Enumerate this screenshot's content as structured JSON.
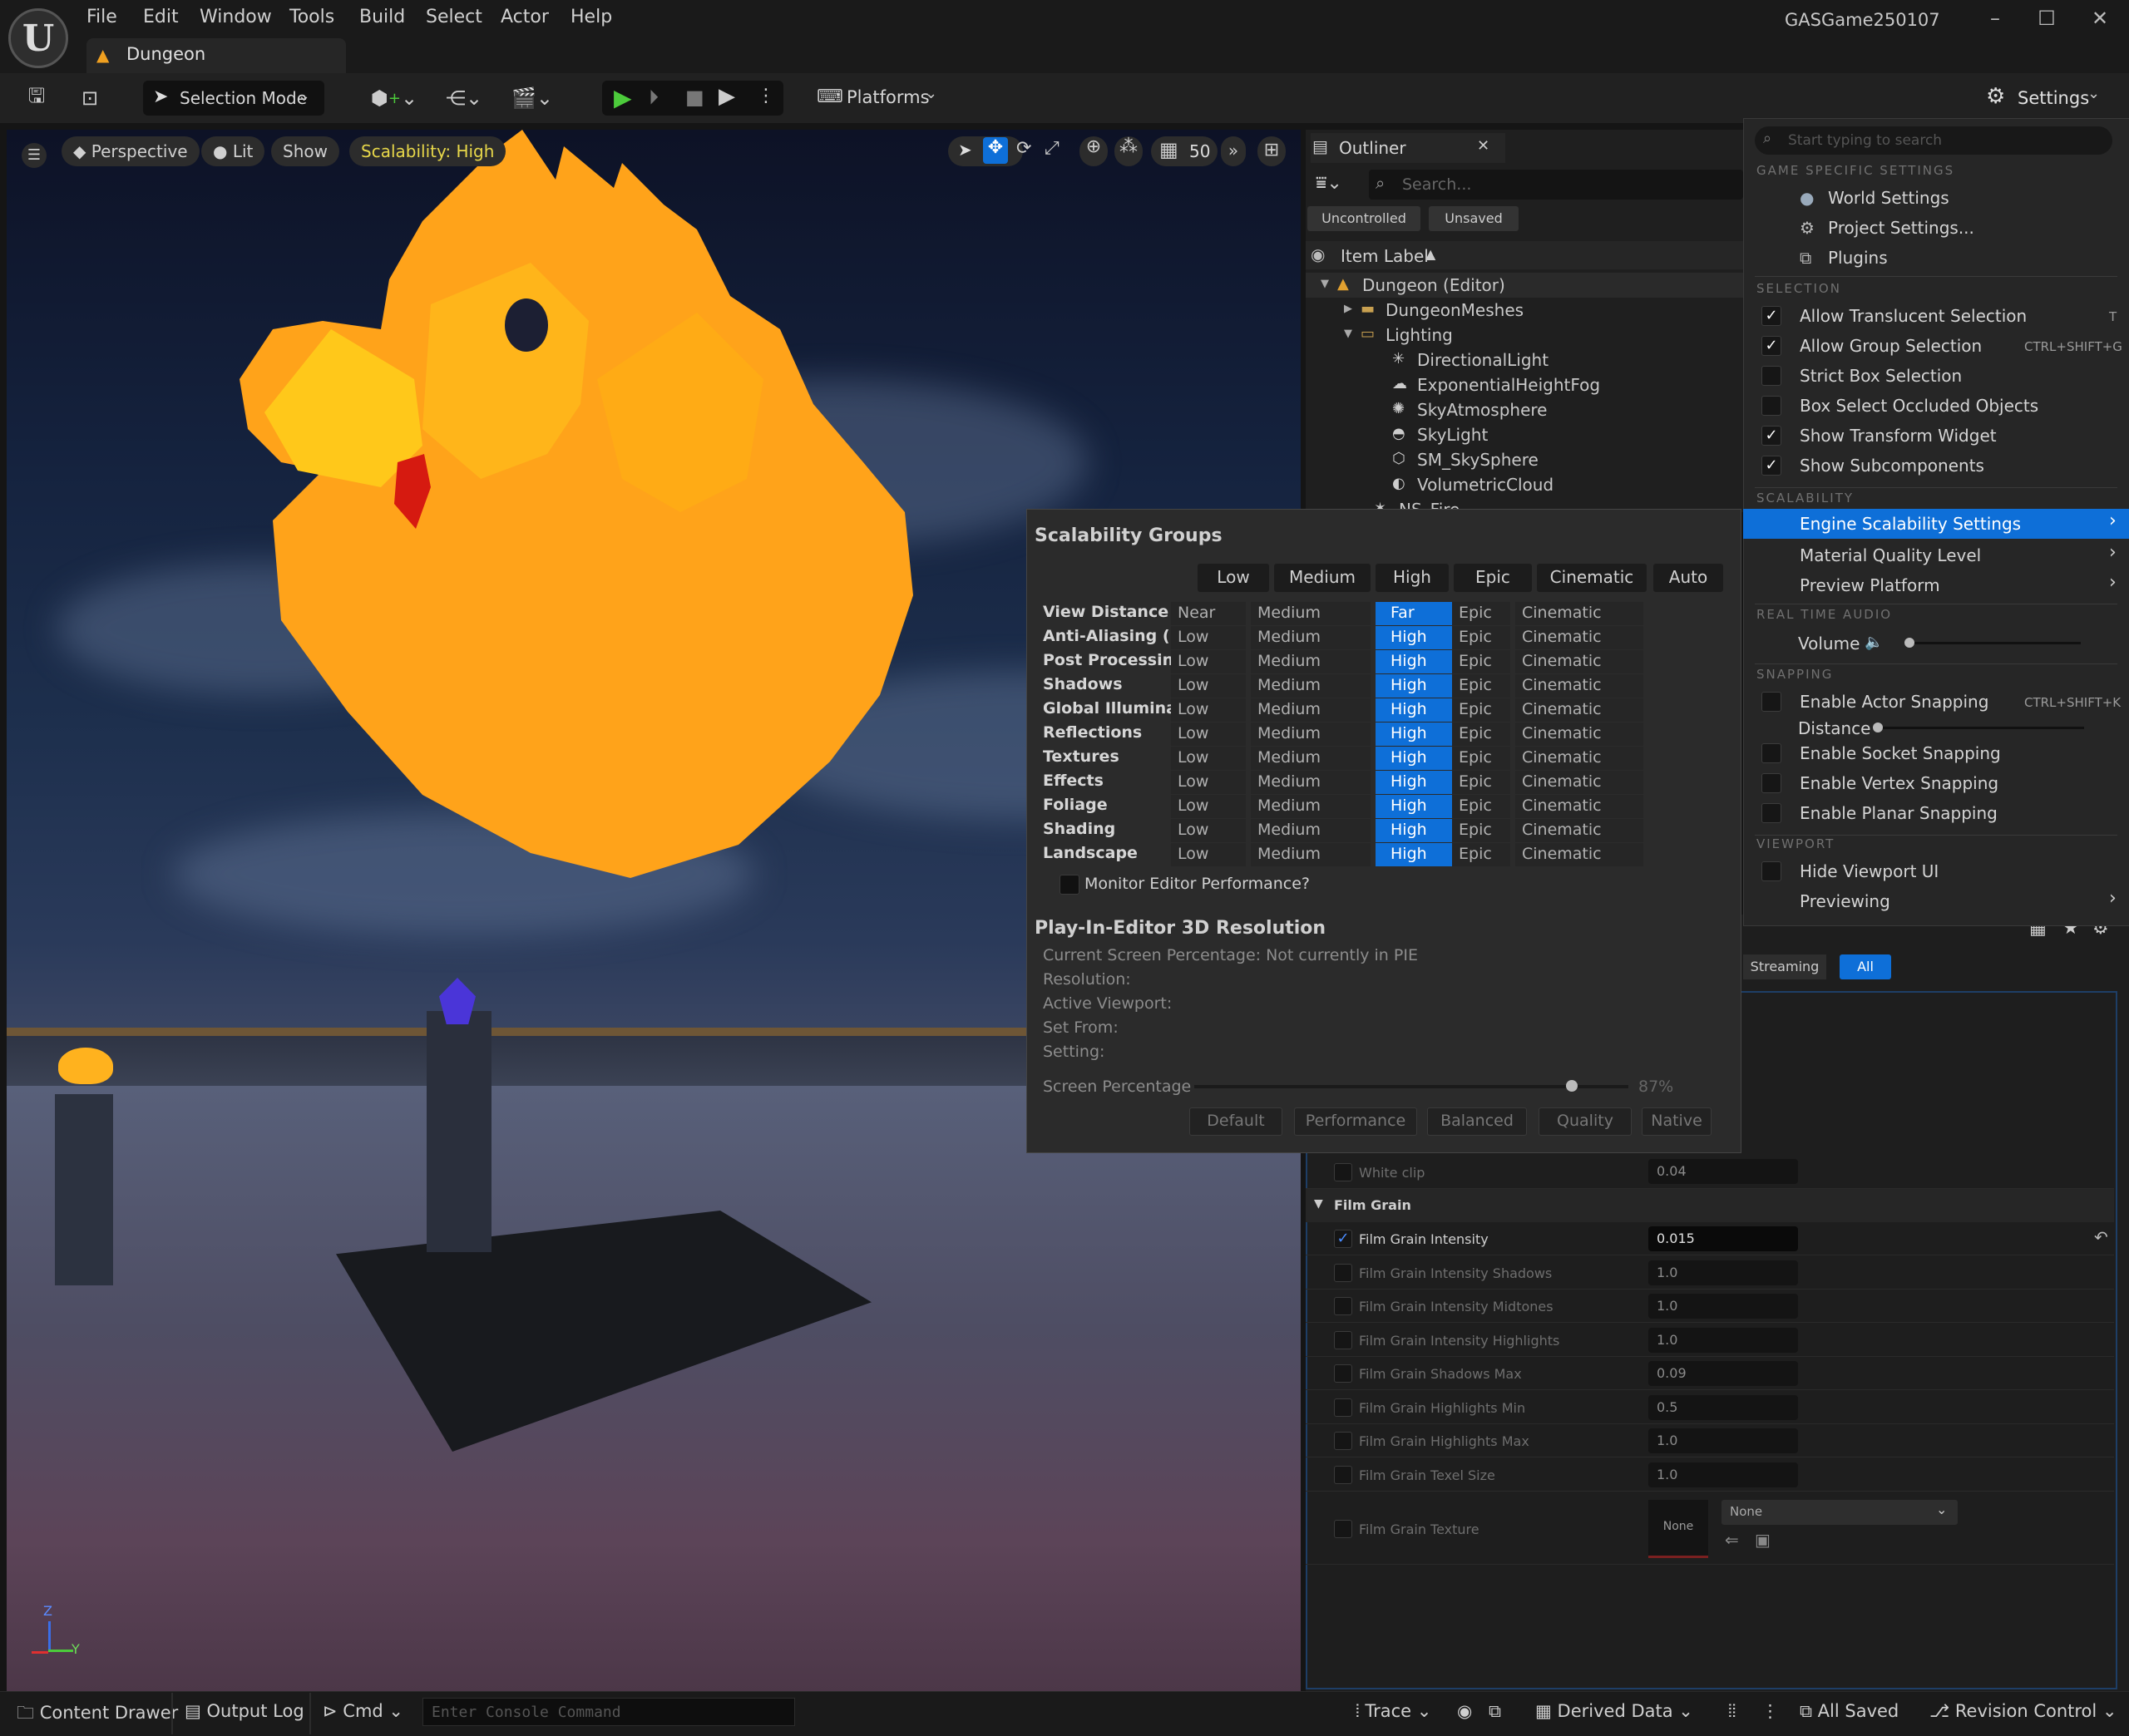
{
  "app": {
    "window_title": "GASGame250107",
    "level_tab": "Dungeon",
    "menu": [
      "File",
      "Edit",
      "Window",
      "Tools",
      "Build",
      "Select",
      "Actor",
      "Help"
    ]
  },
  "toolbar": {
    "selection_mode": "Selection Mode",
    "platforms": "Platforms",
    "settings": "Settings"
  },
  "viewport": {
    "perspective": "Perspective",
    "lit": "Lit",
    "show": "Show",
    "scalability_badge": "Scalability: High",
    "grid_size": "50",
    "axis_z": "Z",
    "axis_y": "Y"
  },
  "outliner": {
    "title": "Outliner",
    "search_placeholder": "Search...",
    "filter_uncontrolled": "Uncontrolled",
    "filter_unsaved": "Unsaved",
    "column": "Item Label",
    "items": [
      {
        "label": "Dungeon (Editor)",
        "icon": "level-icon"
      },
      {
        "label": "DungeonMeshes",
        "icon": "folder-icon"
      },
      {
        "label": "Lighting",
        "icon": "folder-open-icon"
      },
      {
        "label": "DirectionalLight",
        "icon": "directional-light-icon"
      },
      {
        "label": "ExponentialHeightFog",
        "icon": "fog-icon"
      },
      {
        "label": "SkyAtmosphere",
        "icon": "sky-atmosphere-icon"
      },
      {
        "label": "SkyLight",
        "icon": "sky-light-icon"
      },
      {
        "label": "SM_SkySphere",
        "icon": "static-mesh-icon"
      },
      {
        "label": "VolumetricCloud",
        "icon": "cloud-icon"
      },
      {
        "label": "NS_Fire",
        "icon": "niagara-icon"
      }
    ]
  },
  "scalability": {
    "title": "Scalability Groups",
    "presets": [
      "Low",
      "Medium",
      "High",
      "Epic",
      "Cinematic",
      "Auto"
    ],
    "groups": [
      {
        "name": "View Distance",
        "levels": [
          "Near",
          "Medium",
          "Far",
          "Epic",
          "Cinematic"
        ]
      },
      {
        "name": "Anti-Aliasing (None)",
        "levels": [
          "Low",
          "Medium",
          "High",
          "Epic",
          "Cinematic"
        ]
      },
      {
        "name": "Post Processing",
        "levels": [
          "Low",
          "Medium",
          "High",
          "Epic",
          "Cinematic"
        ]
      },
      {
        "name": "Shadows",
        "levels": [
          "Low",
          "Medium",
          "High",
          "Epic",
          "Cinematic"
        ]
      },
      {
        "name": "Global Illumination",
        "levels": [
          "Low",
          "Medium",
          "High",
          "Epic",
          "Cinematic"
        ]
      },
      {
        "name": "Reflections",
        "levels": [
          "Low",
          "Medium",
          "High",
          "Epic",
          "Cinematic"
        ]
      },
      {
        "name": "Textures",
        "levels": [
          "Low",
          "Medium",
          "High",
          "Epic",
          "Cinematic"
        ]
      },
      {
        "name": "Effects",
        "levels": [
          "Low",
          "Medium",
          "High",
          "Epic",
          "Cinematic"
        ]
      },
      {
        "name": "Foliage",
        "levels": [
          "Low",
          "Medium",
          "High",
          "Epic",
          "Cinematic"
        ]
      },
      {
        "name": "Shading",
        "levels": [
          "Low",
          "Medium",
          "High",
          "Epic",
          "Cinematic"
        ]
      },
      {
        "name": "Landscape",
        "levels": [
          "Low",
          "Medium",
          "High",
          "Epic",
          "Cinematic"
        ]
      }
    ],
    "selected_index": 2,
    "monitor_label": "Monitor Editor Performance?",
    "pie_title": "Play-In-Editor 3D Resolution",
    "pie_lines": [
      "Current Screen Percentage: Not currently in PIE",
      "Resolution:",
      "Active Viewport:",
      "Set From:",
      "Setting:"
    ],
    "screen_percentage_label": "Screen Percentage",
    "screen_percentage_value": "87%",
    "screen_percentage_fraction": 0.87,
    "pie_buttons": [
      "Default",
      "Performance",
      "Balanced",
      "Quality",
      "Native"
    ]
  },
  "settings_menu": {
    "search_placeholder": "Start typing to search",
    "sections": {
      "game": "GAME SPECIFIC SETTINGS",
      "selection": "SELECTION",
      "scalability": "SCALABILITY",
      "audio": "REAL TIME AUDIO",
      "snapping": "SNAPPING",
      "viewport": "VIEWPORT"
    },
    "game_items": [
      "World Settings",
      "Project Settings...",
      "Plugins"
    ],
    "selection_items": [
      {
        "label": "Allow Translucent Selection",
        "checked": true,
        "shortcut": "T"
      },
      {
        "label": "Allow Group Selection",
        "checked": true,
        "shortcut": "CTRL+SHIFT+G"
      },
      {
        "label": "Strict Box Selection",
        "checked": false,
        "shortcut": ""
      },
      {
        "label": "Box Select Occluded Objects",
        "checked": false,
        "shortcut": ""
      },
      {
        "label": "Show Transform Widget",
        "checked": true,
        "shortcut": ""
      },
      {
        "label": "Show Subcomponents",
        "checked": true,
        "shortcut": ""
      }
    ],
    "scalability_items": [
      "Engine Scalability Settings",
      "Material Quality Level",
      "Preview Platform"
    ],
    "volume_label": "Volume",
    "volume_level": 0.0,
    "snapping_actor": "Enable Actor Snapping",
    "snapping_actor_shortcut": "CTRL+SHIFT+K",
    "distance_label": "Distance",
    "snapping_items": [
      "Enable Socket Snapping",
      "Enable Vertex Snapping",
      "Enable Planar Snapping"
    ],
    "viewport_items": [
      "Hide Viewport UI",
      "Previewing"
    ]
  },
  "details": {
    "filter_streaming": "Streaming",
    "filter_all": "All",
    "white_clip_label": "White clip",
    "white_clip_value": "0.04",
    "film_grain_section": "Film Grain",
    "rows": [
      {
        "label": "Film Grain Intensity",
        "value": "0.015",
        "checked": true
      },
      {
        "label": "Film Grain Intensity Shadows",
        "value": "1.0",
        "checked": false
      },
      {
        "label": "Film Grain Intensity Midtones",
        "value": "1.0",
        "checked": false
      },
      {
        "label": "Film Grain Intensity Highlights",
        "value": "1.0",
        "checked": false
      },
      {
        "label": "Film Grain Shadows Max",
        "value": "0.09",
        "checked": false
      },
      {
        "label": "Film Grain Highlights Min",
        "value": "0.5",
        "checked": false
      },
      {
        "label": "Film Grain Highlights Max",
        "value": "1.0",
        "checked": false
      },
      {
        "label": "Film Grain Texel Size",
        "value": "1.0",
        "checked": false
      }
    ],
    "texture_label": "Film Grain Texture",
    "texture_thumb": "None",
    "texture_dropdown": "None"
  },
  "status_bar": {
    "content_drawer": "Content Drawer",
    "output_log": "Output Log",
    "cmd": "Cmd",
    "console_placeholder": "Enter Console Command",
    "trace": "Trace",
    "derived_data": "Derived Data",
    "all_saved": "All Saved",
    "revision_control": "Revision Control"
  },
  "colors": {
    "accent": "#0e6fd8",
    "play_green": "#4ccb3b",
    "flame_orange": "#ffa31a",
    "badge_yellow": "#e8d84a"
  }
}
